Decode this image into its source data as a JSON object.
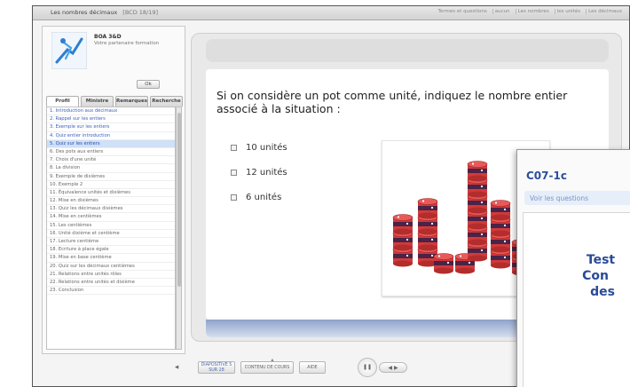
{
  "app": {
    "title": "Les nombres décimaux",
    "code": "[BCD 18/19]",
    "links": [
      "Termes et questions",
      "aucun",
      "Les nombres",
      "les unités",
      "Les décimaux"
    ]
  },
  "sidebar": {
    "brand_name": "BOA 3&D",
    "brand_sub": "Votre partenaire formation",
    "small_button": "Ok",
    "tabs": [
      "Profil",
      "Ministre",
      "Remarques",
      "Recherche"
    ],
    "chapters": [
      {
        "label": "1. Introduction aux décimaux",
        "state": "visited"
      },
      {
        "label": "2. Rappel sur les entiers",
        "state": "visited"
      },
      {
        "label": "3. Exemple sur les entiers",
        "state": "visited"
      },
      {
        "label": "4. Quiz entier introduction",
        "state": "visited"
      },
      {
        "label": "5. Quiz sur les entiers",
        "state": "current"
      },
      {
        "label": "6. Des pots aux entiers",
        "state": ""
      },
      {
        "label": "7. Choix d'une unité",
        "state": ""
      },
      {
        "label": "8. La division",
        "state": ""
      },
      {
        "label": "9. Exemple de dixièmes",
        "state": ""
      },
      {
        "label": "10. Exemple 2",
        "state": ""
      },
      {
        "label": "11. Équivalence unités et dixièmes",
        "state": ""
      },
      {
        "label": "12. Mise en dixièmes",
        "state": ""
      },
      {
        "label": "13. Quiz les décimaux dixièmes",
        "state": ""
      },
      {
        "label": "14. Mise en centièmes",
        "state": ""
      },
      {
        "label": "15. Les centièmes",
        "state": ""
      },
      {
        "label": "16. Unité dixième et centième",
        "state": ""
      },
      {
        "label": "17. Lecture centième",
        "state": ""
      },
      {
        "label": "18. Ecriture à place égale",
        "state": ""
      },
      {
        "label": "19. Mise en base centième",
        "state": ""
      },
      {
        "label": "20. Quiz sur les décimaux centièmes",
        "state": ""
      },
      {
        "label": "21. Relations entre unités rôles",
        "state": ""
      },
      {
        "label": "22. Relations entre unités et dixième",
        "state": ""
      },
      {
        "label": "23. Conclusion",
        "state": ""
      }
    ]
  },
  "question": {
    "text": "Si on considère un pot comme unité, indiquez le nombre entier associé à la situation :",
    "options": [
      "10 unités",
      "12 unités",
      "6 unités"
    ]
  },
  "controls": {
    "prev": "◀",
    "marker": "▲",
    "buttons": [
      "DIAPOSITIVE 5 SUR 28",
      "CONTENU DE COURS",
      "AIDE"
    ],
    "round": "❚❚",
    "pill": "◀ ▶"
  },
  "overlay": {
    "title": "C07-1c",
    "link": "Voir les questions",
    "lines": [
      "Test",
      "Con",
      "des"
    ]
  },
  "colors": {
    "accent_blue": "#2b4f9a",
    "pot_red": "#d23a3a",
    "pot_purple": "#4a2346"
  }
}
